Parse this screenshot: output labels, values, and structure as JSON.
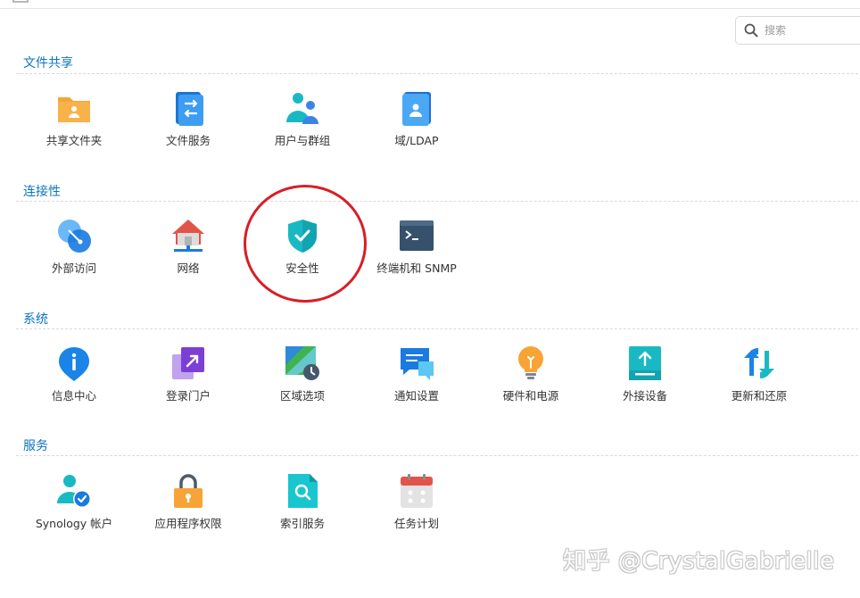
{
  "search": {
    "placeholder": "搜索"
  },
  "sections": [
    {
      "title": "文件共享",
      "items": [
        {
          "label": "共享文件夹",
          "icon": "shared-folder-icon"
        },
        {
          "label": "文件服务",
          "icon": "file-services-icon"
        },
        {
          "label": "用户与群组",
          "icon": "users-groups-icon"
        },
        {
          "label": "域/LDAP",
          "icon": "domain-ldap-icon"
        }
      ]
    },
    {
      "title": "连接性",
      "items": [
        {
          "label": "外部访问",
          "icon": "external-access-icon"
        },
        {
          "label": "网络",
          "icon": "network-icon"
        },
        {
          "label": "安全性",
          "icon": "security-shield-icon"
        },
        {
          "label": "终端机和 SNMP",
          "icon": "terminal-snmp-icon"
        }
      ]
    },
    {
      "title": "系统",
      "items": [
        {
          "label": "信息中心",
          "icon": "info-center-icon"
        },
        {
          "label": "登录门户",
          "icon": "login-portal-icon"
        },
        {
          "label": "区域选项",
          "icon": "regional-options-icon"
        },
        {
          "label": "通知设置",
          "icon": "notification-icon"
        },
        {
          "label": "硬件和电源",
          "icon": "hardware-power-icon"
        },
        {
          "label": "外接设备",
          "icon": "external-devices-icon"
        },
        {
          "label": "更新和还原",
          "icon": "update-restore-icon"
        }
      ]
    },
    {
      "title": "服务",
      "items": [
        {
          "label": "Synology 帐户",
          "icon": "synology-account-icon"
        },
        {
          "label": "应用程序权限",
          "icon": "app-privileges-icon"
        },
        {
          "label": "索引服务",
          "icon": "indexing-service-icon"
        },
        {
          "label": "任务计划",
          "icon": "task-scheduler-icon"
        }
      ]
    }
  ],
  "watermark": "知乎 @CrystalGabrielle",
  "colors": {
    "section_title": "#0d73c2",
    "highlight": "#d81e26",
    "accent_blue": "#1a8ce5",
    "accent_teal": "#19b9c4"
  }
}
